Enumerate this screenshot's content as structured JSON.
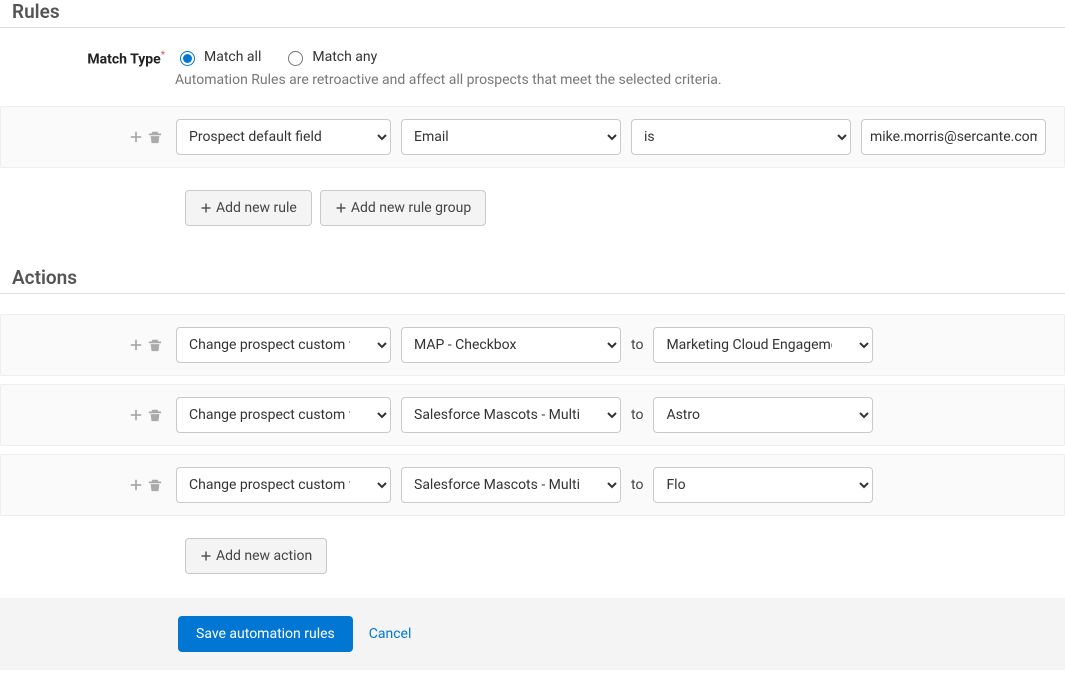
{
  "rules_header": "Rules",
  "actions_header": "Actions",
  "match_type": {
    "label": "Match Type",
    "option_all": "Match all",
    "option_any": "Match any",
    "selected": "all",
    "help": "Automation Rules are retroactive and affect all prospects that meet the selected criteria."
  },
  "rule_row": {
    "field1": "Prospect default field",
    "field2": "Email",
    "operator": "is",
    "value": "mike.morris@sercante.com"
  },
  "add_rule_label": "Add new rule",
  "add_rule_group_label": "Add new rule group",
  "actions": [
    {
      "action": "Change prospect custom field",
      "field": "MAP - Checkbox",
      "to_word": "to",
      "value": "Marketing Cloud Engagement"
    },
    {
      "action": "Change prospect custom field",
      "field": "Salesforce Mascots - Multi-Select",
      "to_word": "to",
      "value": "Astro"
    },
    {
      "action": "Change prospect custom field",
      "field": "Salesforce Mascots - Multi-Select",
      "to_word": "to",
      "value": "Flo"
    }
  ],
  "add_action_label": "Add new action",
  "footer": {
    "save": "Save automation rules",
    "cancel": "Cancel"
  }
}
